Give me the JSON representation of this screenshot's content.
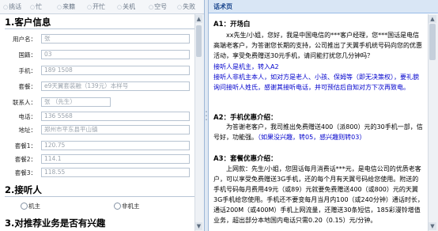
{
  "tabs": [
    {
      "label": "挑话"
    },
    {
      "label": "忙"
    },
    {
      "label": "来籍"
    },
    {
      "label": "开忙"
    },
    {
      "label": "关机"
    },
    {
      "label": "空号"
    },
    {
      "label": "失败"
    }
  ],
  "customer": {
    "section_title": "1.客户信息",
    "fields": [
      {
        "label": "用户名：",
        "value": "张"
      },
      {
        "label": "国籍：",
        "value": "03"
      },
      {
        "label": "手机：",
        "value": "189      1508"
      },
      {
        "label": "套餐：",
        "value": "e9天翼套装融（139元）本样号"
      },
      {
        "label": "联系人：",
        "value": "张      （先生）"
      },
      {
        "label": "电话：",
        "value": "136      5568"
      },
      {
        "label": "地址：",
        "value": "郑州市平东县平山镇      "
      },
      {
        "label": "套餐1：",
        "value": "120.75"
      },
      {
        "label": "套餐2：",
        "value": "114.1"
      },
      {
        "label": "套餐3：",
        "value": "118.55"
      }
    ]
  },
  "receiver": {
    "section_title": "2.接听人",
    "options": [
      {
        "label": "机主"
      },
      {
        "label": "非机主"
      }
    ]
  },
  "next_section_partial": "3.对推荐业务是否有兴趣",
  "script_panel": {
    "title": "话术页",
    "a1_title": "A1：开场白",
    "a1_text": "xx先生/小姐，您好，我是中国电信的***客户经理，您***国话是电信高端老客户，为答谢您长期的支持，公司推出了天翼手机统号码向您的优惠活动，享受免费赠送30元手机，请问能打扰您几分钟吗？",
    "a1_link1": "接听人是机主，转入A2",
    "a1_link2": "接听人非机主本人，如对方是老人、小孩、保姆等（即无决策权），要礼貌询问接听人姓氏，感谢其接听电话，并可预估后自知对方下次再致电。",
    "a2_title": "A2：手机优惠介绍：",
    "a2_text": "为答谢老客户，我司推出免费赠送400（派800）元的30手机一部，信号好，功能强。",
    "a2_links": "（如果没兴趣，转05，感兴趣则转03）",
    "a3_title": "A3：套餐优惠介绍：",
    "a3_text": "上网款：先生/小姐，您固话每月消费话***元，是电信公司的优质老客户，可以享受免费赠送3G手机，还的每个月有天翼号码给您使用。附送的手机号码每月费用49元（或89）元就要免费赠送400（或800）元的天翼3G手机给您使用。手机还不要变每月当月内100（或240分钟）通话时长，通话200M（或400M）手机上网流量，还赠送30条短信，185彩漫铃增值业务，超出部分本地国内电话只需0.20（0.15）元/分钟。"
  }
}
